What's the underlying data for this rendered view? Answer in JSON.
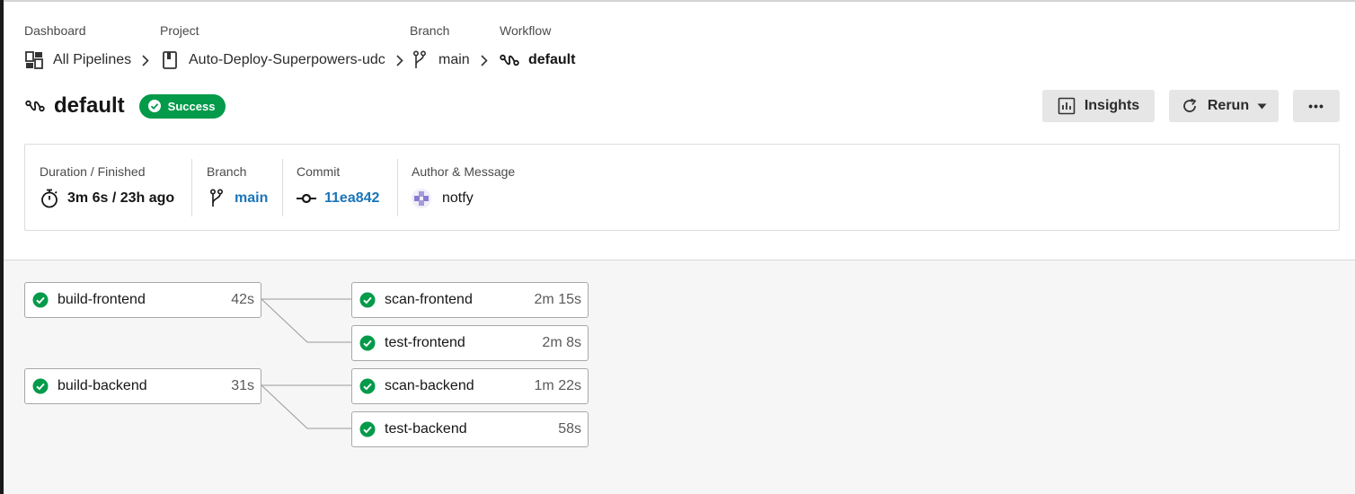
{
  "breadcrumbs": [
    {
      "caption": "Dashboard",
      "value": "All Pipelines",
      "icon": "dashboard-icon"
    },
    {
      "caption": "Project",
      "value": "Auto-Deploy-Superpowers-udc",
      "icon": "project-icon"
    },
    {
      "caption": "Branch",
      "value": "main",
      "icon": "branch-icon"
    },
    {
      "caption": "Workflow",
      "value": "default",
      "icon": "workflow-icon"
    }
  ],
  "header": {
    "title": "default",
    "status": "Success",
    "status_color": "#039a4a",
    "insights_label": "Insights",
    "rerun_label": "Rerun",
    "more_label": "•••"
  },
  "info": {
    "duration_caption": "Duration / Finished",
    "duration_value": "3m 6s / 23h ago",
    "branch_caption": "Branch",
    "branch_value": "main",
    "commit_caption": "Commit",
    "commit_value": "11ea842",
    "author_caption": "Author & Message",
    "author_value": "notfy",
    "link_color": "#1a75b8"
  },
  "jobs": [
    {
      "name": "build-frontend",
      "duration": "42s",
      "status": "success"
    },
    {
      "name": "scan-frontend",
      "duration": "2m 15s",
      "status": "success"
    },
    {
      "name": "test-frontend",
      "duration": "2m 8s",
      "status": "success"
    },
    {
      "name": "build-backend",
      "duration": "31s",
      "status": "success"
    },
    {
      "name": "scan-backend",
      "duration": "1m 22s",
      "status": "success"
    },
    {
      "name": "test-backend",
      "duration": "58s",
      "status": "success"
    }
  ],
  "edges": [
    [
      "build-frontend",
      "scan-frontend"
    ],
    [
      "build-frontend",
      "test-frontend"
    ],
    [
      "build-backend",
      "scan-backend"
    ],
    [
      "build-backend",
      "test-backend"
    ]
  ]
}
